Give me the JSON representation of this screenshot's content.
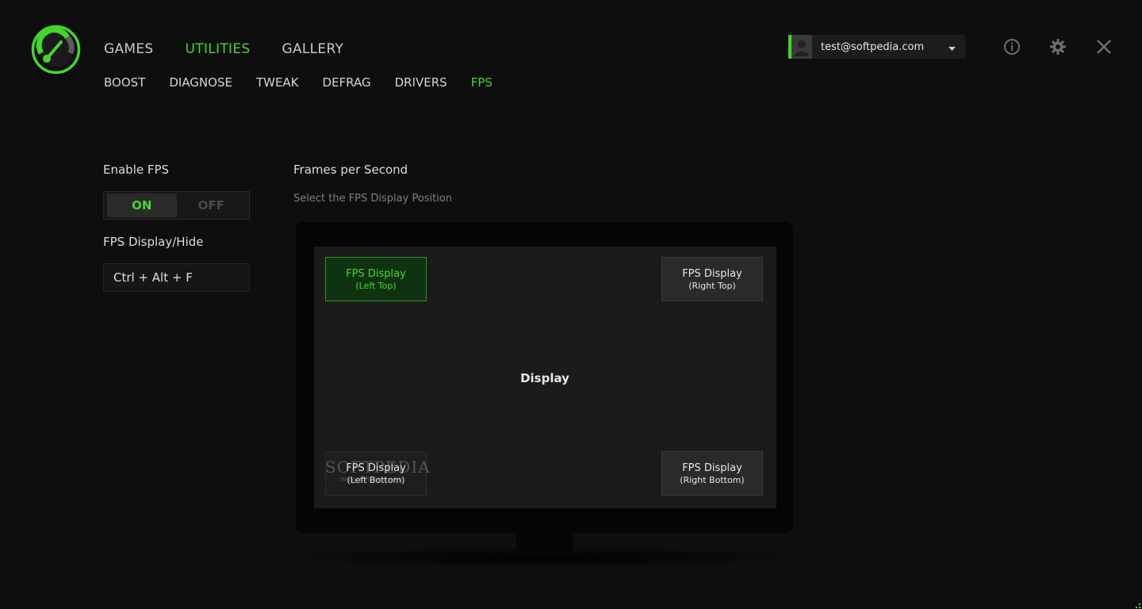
{
  "main_nav": [
    {
      "label": "GAMES",
      "active": false
    },
    {
      "label": "UTILITIES",
      "active": true
    },
    {
      "label": "GALLERY",
      "active": false
    }
  ],
  "sub_nav": [
    {
      "label": "BOOST",
      "active": false
    },
    {
      "label": "DIAGNOSE",
      "active": false
    },
    {
      "label": "TWEAK",
      "active": false
    },
    {
      "label": "DEFRAG",
      "active": false
    },
    {
      "label": "DRIVERS",
      "active": false
    },
    {
      "label": "FPS",
      "active": true
    }
  ],
  "account": {
    "email": "test@softpedia.com"
  },
  "icons": {
    "info": "info-icon",
    "settings": "gear-icon",
    "close": "close-icon"
  },
  "colors": {
    "accent": "#44d62c",
    "background": "#0e0e0e"
  },
  "left_panel": {
    "enable_label": "Enable FPS",
    "toggle_on": "ON",
    "toggle_off": "OFF",
    "toggle_state": "ON",
    "hotkey_label": "FPS Display/Hide",
    "hotkey_value": "Ctrl + Alt + F"
  },
  "fps_panel": {
    "title": "Frames per Second",
    "subtitle": "Select the FPS Display Position",
    "display_label": "Display",
    "positions": [
      {
        "title": "FPS Display",
        "sub": "(Left Top)",
        "selected": true
      },
      {
        "title": "FPS Display",
        "sub": "(Right Top)",
        "selected": false
      },
      {
        "title": "FPS Display",
        "sub": "(Left Bottom)",
        "selected": false
      },
      {
        "title": "FPS Display",
        "sub": "(Right Bottom)",
        "selected": false
      }
    ]
  },
  "watermark": {
    "brand": "SOFTPEDIA",
    "url": "www.softpedia.com"
  }
}
